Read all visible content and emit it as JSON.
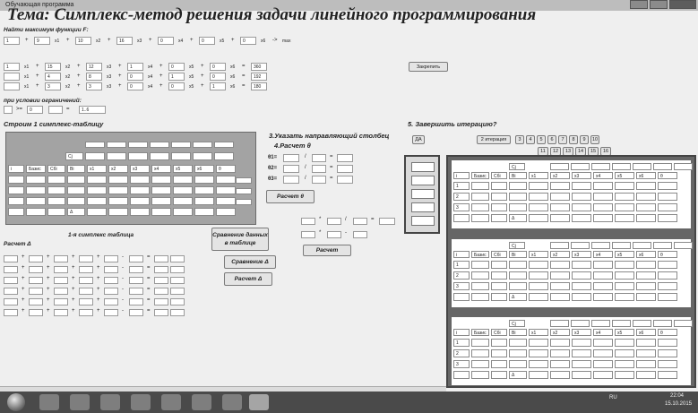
{
  "window": {
    "caption": "Обучающая программа"
  },
  "title": "Тема: Симплекс-метод решения задачи линейного программирования",
  "objective": {
    "label": "Найти максимум функции F:",
    "row": [
      "1",
      "+",
      "9",
      "x1",
      "+",
      "10",
      "x2",
      "+",
      "16",
      "x3",
      "+",
      "0",
      "x4",
      "+",
      "0",
      "x5",
      "+",
      "0",
      "x6",
      "->",
      "max"
    ]
  },
  "constraints": [
    [
      "1",
      "x1",
      "+",
      "15",
      "x2",
      "+",
      "12",
      "x3",
      "+",
      "1",
      "x4",
      "+",
      "0",
      "x5",
      "+",
      "0",
      "x6",
      "=",
      "360"
    ],
    [
      "",
      "x1",
      "+",
      "4",
      "x2",
      "+",
      "8",
      "x3",
      "+",
      "0",
      "x4",
      "+",
      "1",
      "x5",
      "+",
      "0",
      "x6",
      "=",
      "192"
    ],
    [
      "",
      "x1",
      "+",
      "3",
      "x2",
      "+",
      "3",
      "x3",
      "+",
      "0",
      "x4",
      "+",
      "0",
      "x5",
      "+",
      "1",
      "x6",
      "=",
      "180"
    ]
  ],
  "fix_button": "Закрепить",
  "conditions": {
    "label": "при условии ограничений:",
    "row": [
      "",
      ">=",
      "0",
      "",
      "=",
      "1..6"
    ]
  },
  "step1": {
    "label": "Строим 1 симплекс-таблицу",
    "headers": [
      "i",
      "Базис",
      "Сбi",
      "Bi",
      "x1",
      "x2",
      "x3",
      "x4",
      "x5",
      "x6",
      "θ"
    ],
    "c_label": "Cj",
    "delta_label": "Δ"
  },
  "step3": {
    "label": "3.Указать направляющий столбец",
    "sub": "4.Расчет θ",
    "rows": [
      "θ1=",
      "θ2=",
      "θ3="
    ],
    "slash": "/",
    "eq": "=",
    "button": "Расчет θ"
  },
  "first_table": {
    "label": "1-я симплекс таблица",
    "sub": "Расчет Δ",
    "signs": [
      "+",
      "+",
      "+",
      "+",
      "-",
      "="
    ]
  },
  "compare_table_button": "Сравнение данных в таблице",
  "compare_delta_button": "Сравнение Δ",
  "calc_delta_button": "Расчет Δ",
  "calc_row": {
    "times": "*",
    "slash": "/",
    "eq": "=",
    "minus": "-",
    "button": "Расчет"
  },
  "step5": {
    "label": "5. Завершить итерацию?",
    "yes_button": "ДА",
    "iter_button": "2 итерация",
    "iterations_row1": [
      "3",
      "4",
      "5",
      "6",
      "7",
      "8",
      "9",
      "10"
    ],
    "iterations_row2": [
      "11",
      "12",
      "13",
      "14",
      "15",
      "16"
    ]
  },
  "right_tables": {
    "headers": [
      "i",
      "Базис",
      "Сбi",
      "Bi",
      "x1",
      "x2",
      "x3",
      "x4",
      "x5",
      "x6",
      "θ"
    ],
    "c_label": "Cj",
    "rows": [
      "1",
      "2",
      "3"
    ],
    "delta_label": "Δ"
  },
  "taskbar": {
    "lang": "RU",
    "time": "22:04",
    "date": "15.10.2015"
  }
}
